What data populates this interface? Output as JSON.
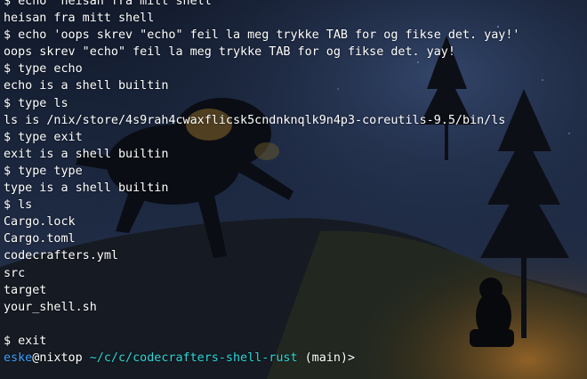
{
  "terminal": {
    "lines": [
      "$ echo \"heisan fra mitt shell\"",
      "heisan fra mitt shell",
      "$ echo 'oops skrev \"echo\" feil la meg trykke TAB for og fikse det. yay!'",
      "oops skrev \"echo\" feil la meg trykke TAB for og fikse det. yay!",
      "$ type echo",
      "echo is a shell builtin",
      "$ type ls",
      "ls is /nix/store/4s9rah4cwaxflicsk5cndnknqlk9n4p3-coreutils-9.5/bin/ls",
      "$ type exit",
      "exit is a shell builtin",
      "$ type type",
      "type is a shell builtin",
      "$ ls",
      "Cargo.lock",
      "Cargo.toml",
      "codecrafters.yml",
      "src",
      "target",
      "your_shell.sh",
      "",
      "$ exit"
    ],
    "prompt": {
      "user": "eske",
      "at": "@",
      "host": "nixtop",
      "cwd": " ~/c/c/codecrafters-shell-rust",
      "branch": " (main)",
      "caret": ">"
    }
  },
  "colors": {
    "text": "#ffffff",
    "user": "#3aa0ff",
    "cwd": "#2ad7d7"
  }
}
